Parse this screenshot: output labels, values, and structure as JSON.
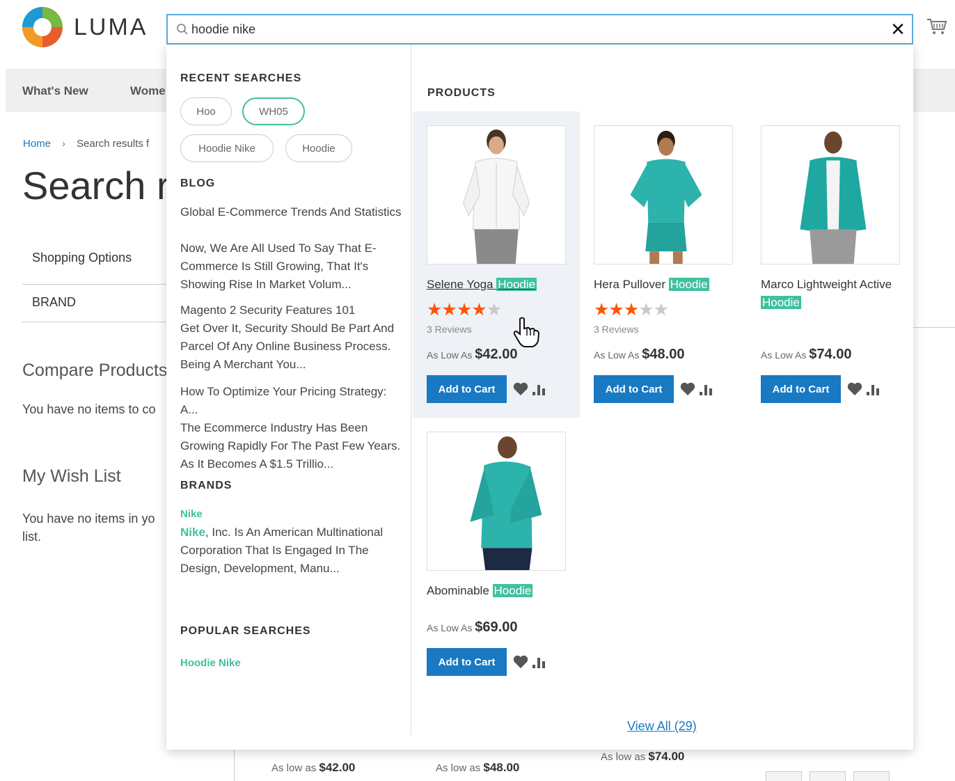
{
  "header": {
    "logo_text": "LUMA",
    "search_value": "hoodie nike",
    "clear_label": "✕"
  },
  "nav": {
    "items": [
      "What's New",
      "Wome"
    ]
  },
  "breadcrumb": {
    "home": "Home",
    "separator": "›",
    "current": "Search results f"
  },
  "page_title": "Search re",
  "sidebar": {
    "shopping_options": "Shopping Options",
    "brand": "BRAND",
    "compare_title": "Compare Products",
    "compare_text": "You have no items to co",
    "wishlist_title": "My Wish List",
    "wishlist_text_line1": "You have no items in yo",
    "wishlist_text_line2": "list."
  },
  "background_prices": [
    {
      "label": "As low as",
      "value": "$42.00"
    },
    {
      "label": "As low as",
      "value": "$48.00"
    },
    {
      "label": "As low as",
      "value": "$74.00"
    }
  ],
  "dropdown": {
    "recent_title": "RECENT SEARCHES",
    "recent": [
      "Hoo",
      "WH05",
      "Hoodie Nike",
      "Hoodie"
    ],
    "blog_title": "BLOG",
    "blog": [
      "Global E-Commerce Trends And Statistics",
      "Now, We Are All Used To Say That E-Commerce Is Still Growing, That It's Showing Rise In Market Volum...",
      "Magento 2 Security Features 101",
      "Get Over It, Security Should Be Part And Parcel Of Any Online Business Process. Being A Merchant You...",
      "How To Optimize Your Pricing Strategy: A...",
      "The Ecommerce Industry Has Been Growing Rapidly For The Past Few Years. As It Becomes A $1.5 Trillio..."
    ],
    "brands_title": "BRANDS",
    "brand_name": "Nike",
    "brand_desc_highlight": "Nike",
    "brand_desc": ", Inc. Is An American Multinational Corporation That Is Engaged In The Design, Development, Manu...",
    "popular_title": "POPULAR SEARCHES",
    "popular": [
      "Hoodie Nike"
    ],
    "products_title": "PRODUCTS",
    "products": [
      {
        "name": "Selene Yoga",
        "highlight": "Hoodie",
        "rating": 4,
        "reviews": "3 Reviews",
        "price_label": "As Low As",
        "price": "$42.00",
        "add_label": "Add to Cart"
      },
      {
        "name": "Hera Pullover",
        "highlight": "Hoodie",
        "rating": 3.5,
        "reviews": "3 Reviews",
        "price_label": "As Low As",
        "price": "$48.00",
        "add_label": "Add to Cart"
      },
      {
        "name": "Marco Lightweight Active",
        "highlight": "Hoodie",
        "price_label": "As Low As",
        "price": "$74.00",
        "add_label": "Add to Cart"
      },
      {
        "name": "Abominable",
        "highlight": "Hoodie",
        "price_label": "As Low As",
        "price": "$69.00",
        "add_label": "Add to Cart"
      }
    ],
    "view_all": "View All (29)"
  },
  "colors": {
    "accent": "#1979c3",
    "highlight": "#3fc0a0",
    "stars": "#ff5501"
  },
  "icons": [
    "search-icon",
    "close-icon",
    "cart-icon",
    "heart-icon",
    "compare-icon",
    "hand-cursor-icon"
  ]
}
